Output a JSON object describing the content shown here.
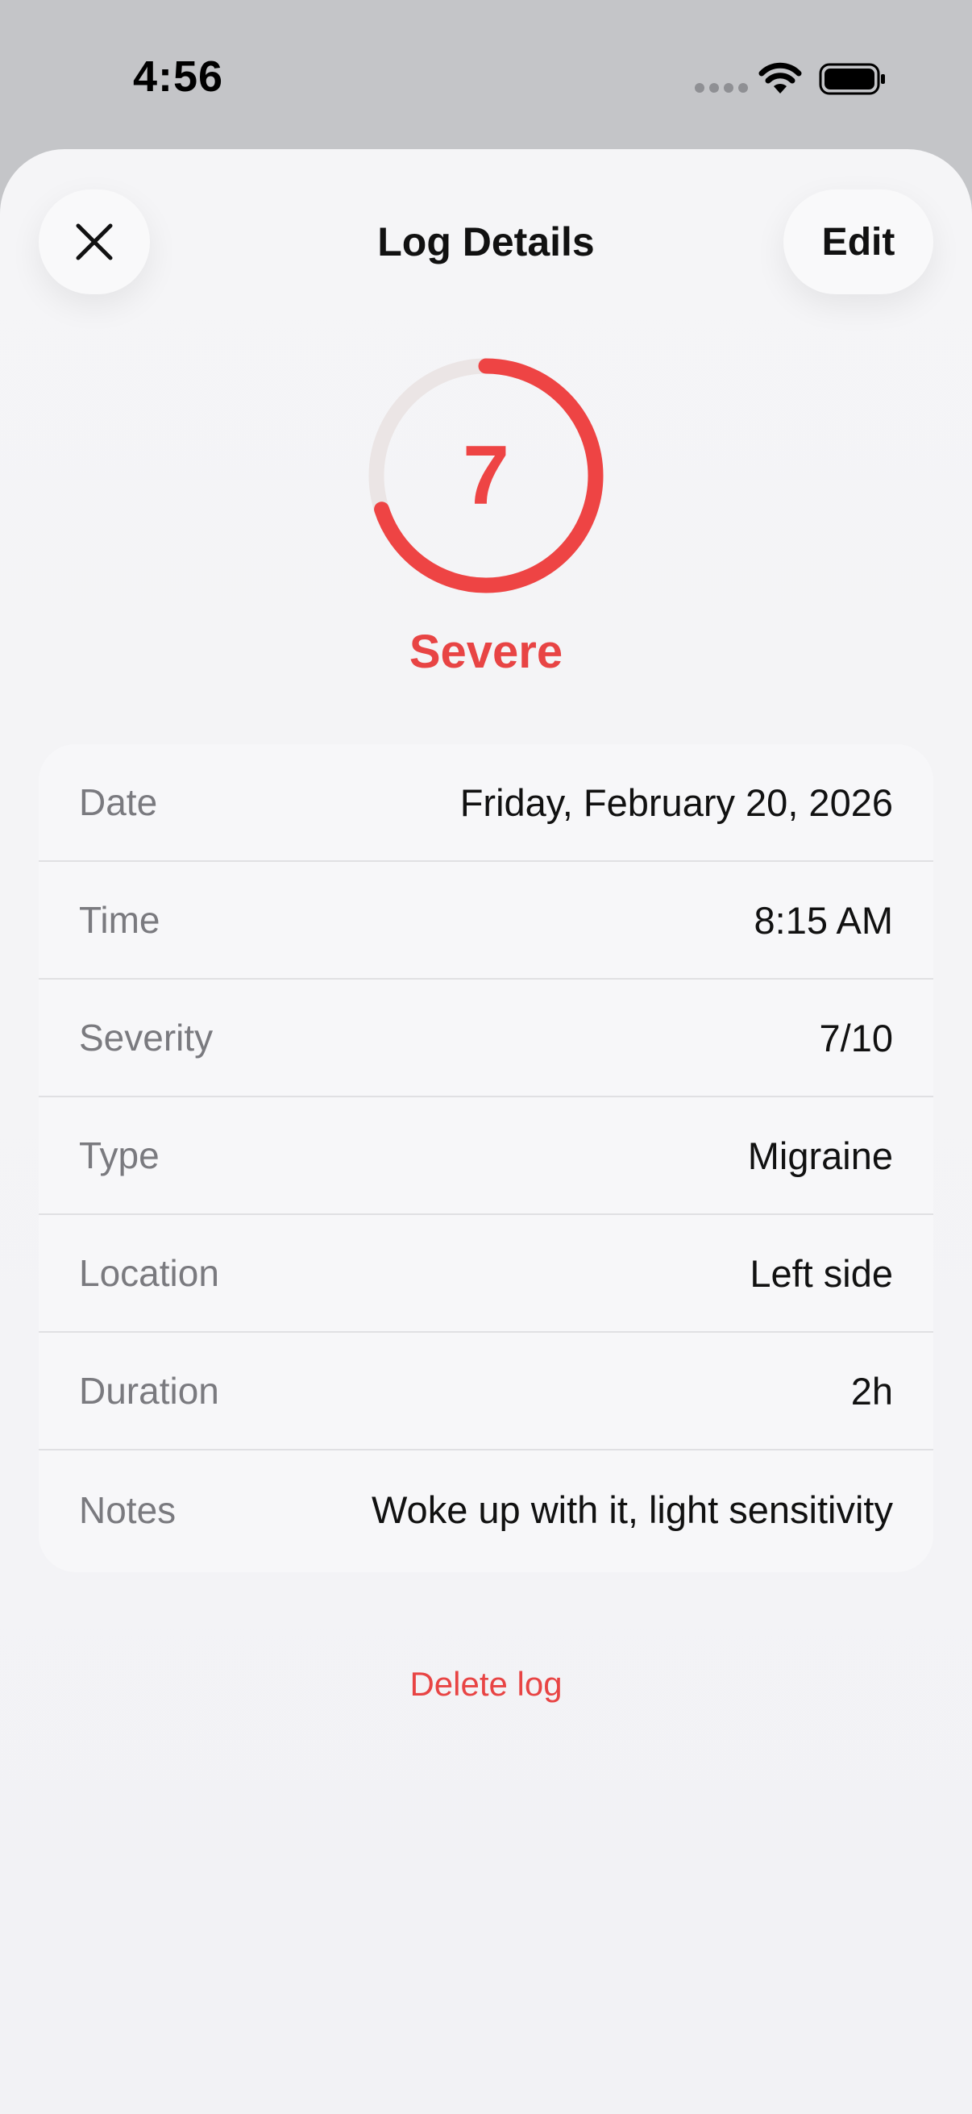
{
  "status_bar": {
    "time": "4:56",
    "icons": [
      "signal-dots-icon",
      "wifi-icon",
      "battery-icon"
    ]
  },
  "header": {
    "close_icon": "close-icon",
    "title": "Log Details",
    "edit_label": "Edit"
  },
  "severity": {
    "value": "7",
    "max": 10,
    "fraction": 0.7,
    "label": "Severe",
    "color": "#ee4444"
  },
  "details": {
    "rows": [
      {
        "label": "Date",
        "value": "Friday, February 20, 2026"
      },
      {
        "label": "Time",
        "value": "8:15 AM"
      },
      {
        "label": "Severity",
        "value": "7/10"
      },
      {
        "label": "Type",
        "value": "Migraine"
      },
      {
        "label": "Location",
        "value": "Left side"
      },
      {
        "label": "Duration",
        "value": "2h"
      },
      {
        "label": "Notes",
        "value": "Woke up with it, light sensitivity"
      }
    ]
  },
  "actions": {
    "delete_label": "Delete log"
  },
  "colors": {
    "accent": "#ee4444",
    "ring_track": "#ebe5e5",
    "sheet_background": "#f4f4f6",
    "system_background": "#c4c5c8"
  }
}
